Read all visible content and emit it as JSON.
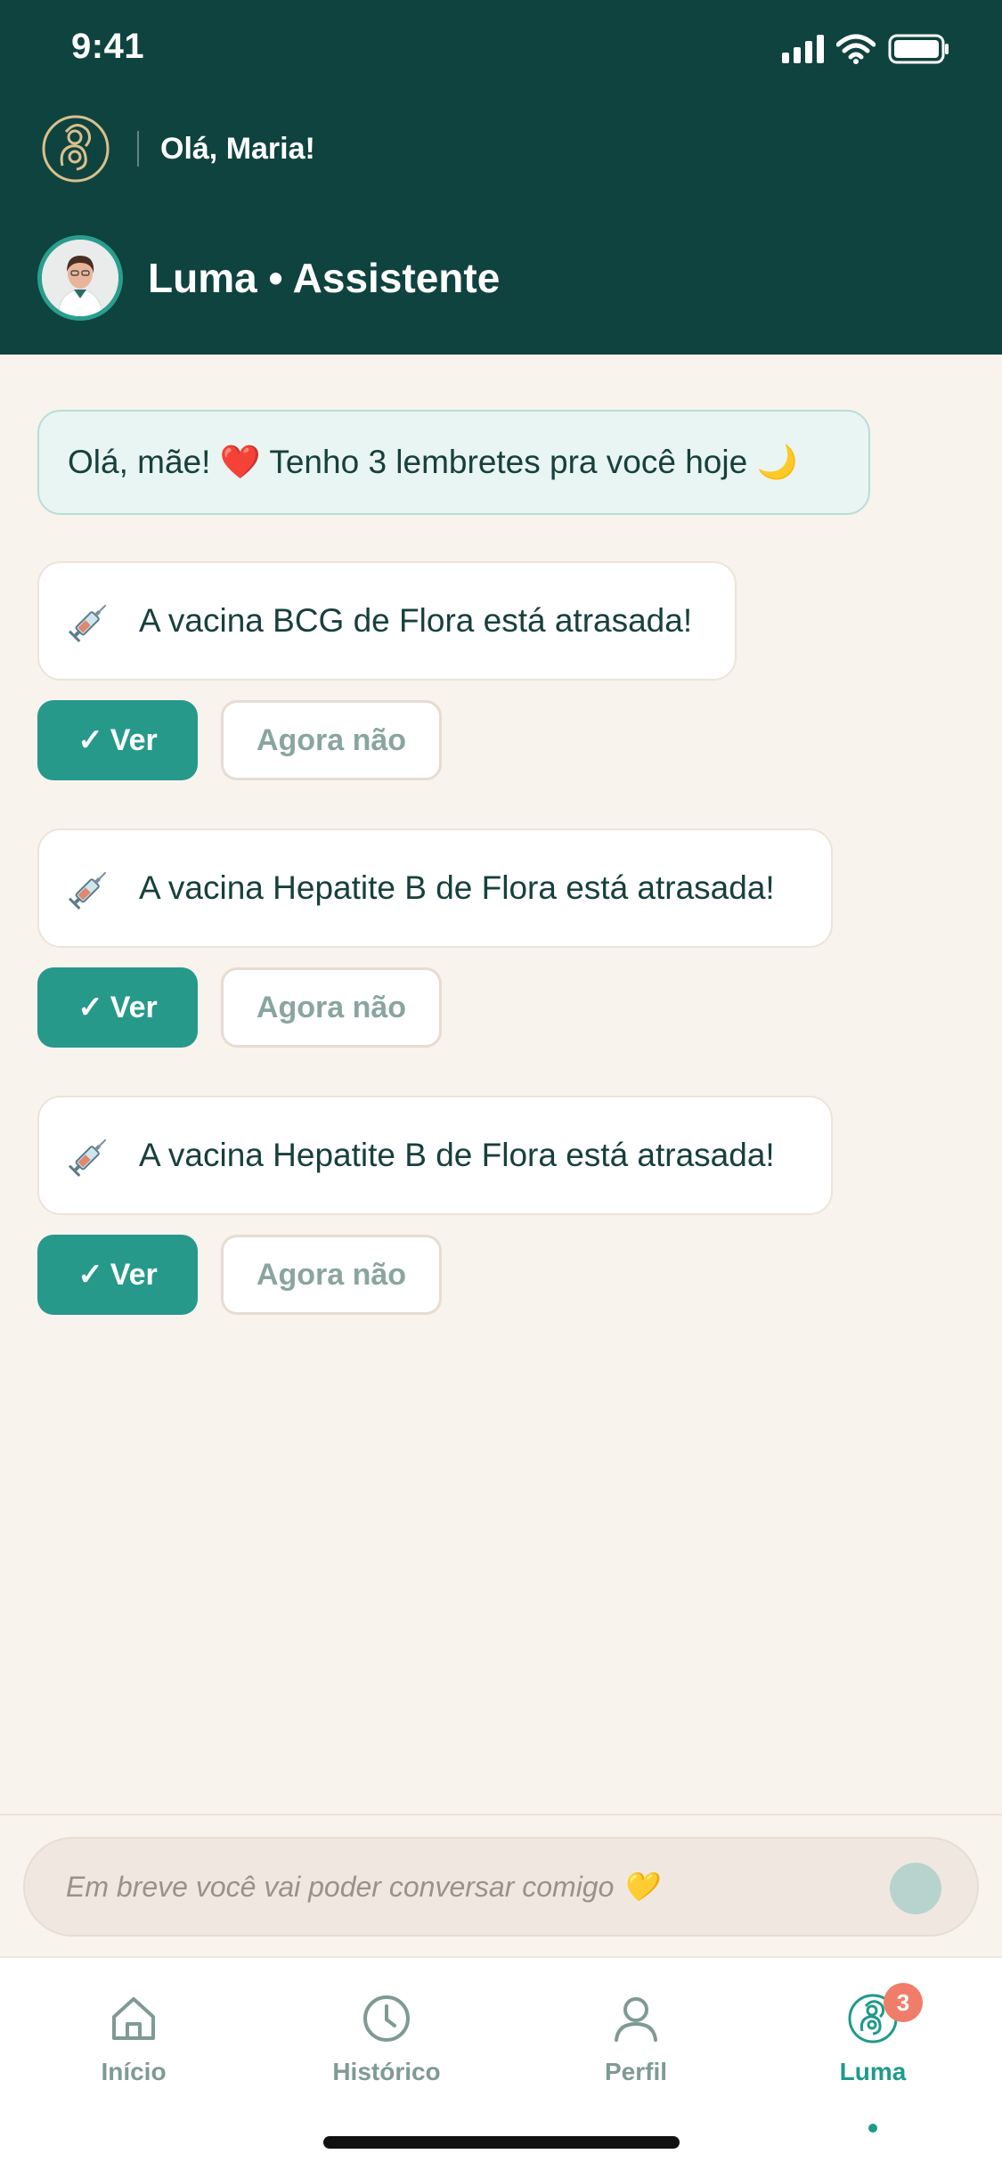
{
  "status_bar": {
    "time": "9:41"
  },
  "header": {
    "greeting": "Olá, Maria!",
    "assistant_title": "Luma • Assistente"
  },
  "chat": {
    "intro_message": "Olá, mãe! ❤️ Tenho 3 lembretes pra você hoje 🌙",
    "reminders": [
      {
        "icon": "syringe-icon",
        "text": "A vacina BCG de Flora está atrasada!",
        "view_label": "Ver",
        "dismiss_label": "Agora não"
      },
      {
        "icon": "syringe-icon",
        "text": "A vacina Hepatite B de Flora está atrasada!",
        "view_label": "Ver",
        "dismiss_label": "Agora não"
      },
      {
        "icon": "syringe-icon",
        "text": "A vacina Hepatite B de Flora está atrasada!",
        "view_label": "Ver",
        "dismiss_label": "Agora não"
      }
    ]
  },
  "input": {
    "placeholder": "Em breve você vai poder conversar comigo 💛"
  },
  "tab_bar": {
    "tabs": [
      {
        "icon": "home-icon",
        "label": "Início",
        "active": false
      },
      {
        "icon": "clock-icon",
        "label": "Histórico",
        "active": false
      },
      {
        "icon": "person-icon",
        "label": "Perfil",
        "active": false
      },
      {
        "icon": "mother-baby-logo-icon",
        "label": "Luma",
        "active": true,
        "badge": "3"
      }
    ]
  },
  "colors": {
    "header_bg": "#0f433f",
    "accent": "#26998b",
    "background": "#f8f3ed",
    "badge": "#ef7d6a"
  }
}
